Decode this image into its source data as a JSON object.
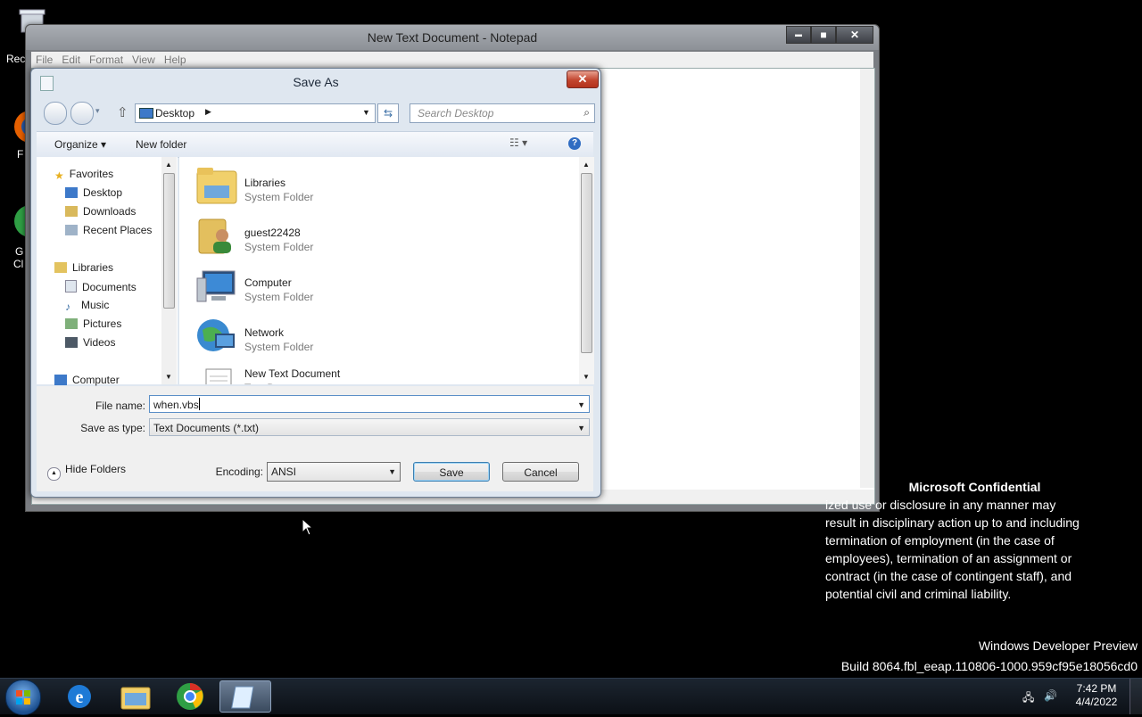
{
  "notepad": {
    "title": "New Text Document - Notepad",
    "minimize": "▬",
    "maximize": "■",
    "close": "✕",
    "menu": [
      "File",
      "Edit",
      "Format",
      "View",
      "Help"
    ]
  },
  "dialog": {
    "title": "Save As",
    "close": "✕",
    "address": "Desktop",
    "search_placeholder": "Search Desktop",
    "toolbar": {
      "organize": "Organize ▾",
      "new_folder": "New folder",
      "help": "?"
    },
    "nav": {
      "favorites": "Favorites",
      "desktop": "Desktop",
      "downloads": "Downloads",
      "recent": "Recent Places",
      "libraries": "Libraries",
      "documents": "Documents",
      "music": "Music",
      "pictures": "Pictures",
      "videos": "Videos",
      "computer": "Computer"
    },
    "files": [
      {
        "name": "Libraries",
        "type": "System Folder"
      },
      {
        "name": "guest22428",
        "type": "System Folder"
      },
      {
        "name": "Computer",
        "type": "System Folder"
      },
      {
        "name": "Network",
        "type": "System Folder"
      },
      {
        "name": "New Text Document",
        "type": "Text Document"
      }
    ],
    "file_name_label": "File name:",
    "file_name_value": "when.vbs",
    "save_type_label": "Save as type:",
    "save_type_value": "Text Documents (*.txt)",
    "hide_folders": "Hide Folders",
    "encoding_label": "Encoding:",
    "encoding_value": "ANSI",
    "save": "Save",
    "cancel": "Cancel"
  },
  "desktop": {
    "confidential_title": "Microsoft Confidential",
    "confidential_lines": [
      "ized use or disclosure in any manner may",
      "result in disciplinary action up to and including",
      "termination of employment (in the case of",
      "employees), termination of an assignment or",
      "contract (in the case of contingent staff), and",
      "potential civil and criminal liability."
    ],
    "watermark_line1": "Windows Developer Preview",
    "watermark_line2": "Build 8064.fbl_eeap.110806-1000.959cf95e18056cd0",
    "icon_labels": [
      "Rec",
      "F",
      "G",
      "Cl"
    ]
  },
  "taskbar": {
    "time": "7:42 PM",
    "date": "4/4/2022"
  }
}
